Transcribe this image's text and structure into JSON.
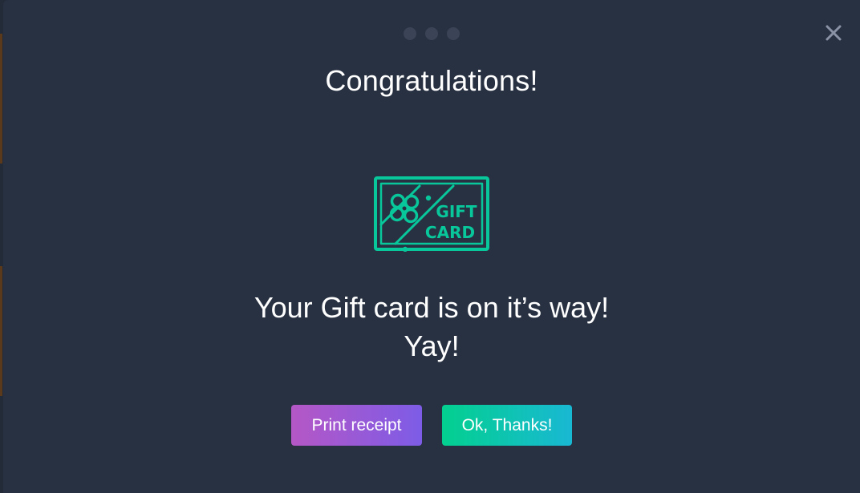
{
  "modal": {
    "title": "Congratulations!",
    "close_icon": "close-icon",
    "pagination": {
      "count": 3
    },
    "illustration": {
      "icon": "gift-card-icon",
      "line1": "GIFT",
      "line2": "CARD",
      "color": "#08c79a"
    },
    "message_line1": "Your Gift card is on it’s way!",
    "message_line2": "Yay!",
    "buttons": {
      "print_label": "Print receipt",
      "ok_label": "Ok, Thanks!"
    }
  },
  "colors": {
    "modal_bg": "#283142",
    "dot": "#3a4456",
    "accent_green": "#03d08f",
    "accent_purple": "#b557c6"
  }
}
